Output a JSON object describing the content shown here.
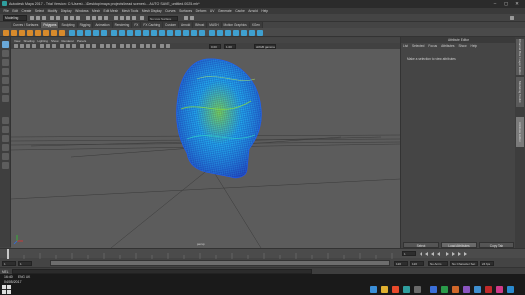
{
  "window": {
    "title": "Autodesk Maya 2017 - Trial Version: C:\\Users\\...\\Desktop\\maya projects\\head scenes\\... AUTO SAVE_untitled.0025.mb*",
    "controls": [
      "minimize-icon",
      "maximize-icon",
      "close-icon"
    ]
  },
  "menubar": {
    "items": [
      "File",
      "Edit",
      "Create",
      "Select",
      "Modify",
      "Display",
      "Windows",
      "Mesh",
      "Edit Mesh",
      "Mesh Tools",
      "Mesh Display",
      "Curves",
      "Surfaces",
      "Deform",
      "UV",
      "Generate",
      "Cache",
      "Arnold",
      "Help"
    ]
  },
  "statusline": {
    "mode": "Modeling",
    "symmetry": "No Live Surface"
  },
  "shelf": {
    "tabs": [
      "Curves / Surfaces",
      "Polygons",
      "Sculpting",
      "Rigging",
      "Animation",
      "Rendering",
      "FX",
      "FX Caching",
      "Custom",
      "Arnold",
      "Bifrost",
      "MASH",
      "Motion Graphics",
      "XGen"
    ],
    "active_tab": "Polygons"
  },
  "viewport": {
    "menu": [
      "View",
      "Shading",
      "Lighting",
      "Show",
      "Renderer",
      "Panels"
    ],
    "camera_field": "sRGB gamma",
    "value1": "0.00",
    "value2": "1.00",
    "camera_label": "persp"
  },
  "attribute_editor": {
    "header": "Attribute Editor",
    "menu": [
      "List",
      "Selected",
      "Focus",
      "Attributes",
      "Show",
      "Help"
    ],
    "message": "Make a selection to view attributes",
    "buttons": [
      "Select",
      "Load Attributes",
      "Copy Tab"
    ]
  },
  "side_tabs": [
    "Channel Box / Layer Editor",
    "Modeling Toolkit",
    "Attribute Editor"
  ],
  "timeslider": {
    "ticks": [
      "1",
      "5",
      "10",
      "15",
      "20",
      "25",
      "30",
      "35",
      "40",
      "45",
      "50",
      "55",
      "60",
      "65",
      "70",
      "75",
      "80",
      "85",
      "90",
      "95",
      "100",
      "105",
      "110",
      "115",
      "120"
    ],
    "current_frame": "1"
  },
  "rangeslider": {
    "start": "1",
    "inner_start": "1",
    "inner_end": "120",
    "end": "120",
    "end2": "200",
    "anim_layer": "No Anim Layer",
    "char_set": "No Character Set",
    "fps": "24 fps"
  },
  "cmdline": {
    "label": "MEL"
  },
  "taskbar": {
    "time": "16:40",
    "date": "04/05/2017",
    "tray": [
      "ENG",
      "UK"
    ]
  },
  "colors": {
    "viewport_bg": "#5c5c5c",
    "accent": "#5fb8ff",
    "mesh_colors": [
      "#1fa8ff",
      "#2ed0c8",
      "#8ee03a",
      "#1f5fff"
    ]
  }
}
